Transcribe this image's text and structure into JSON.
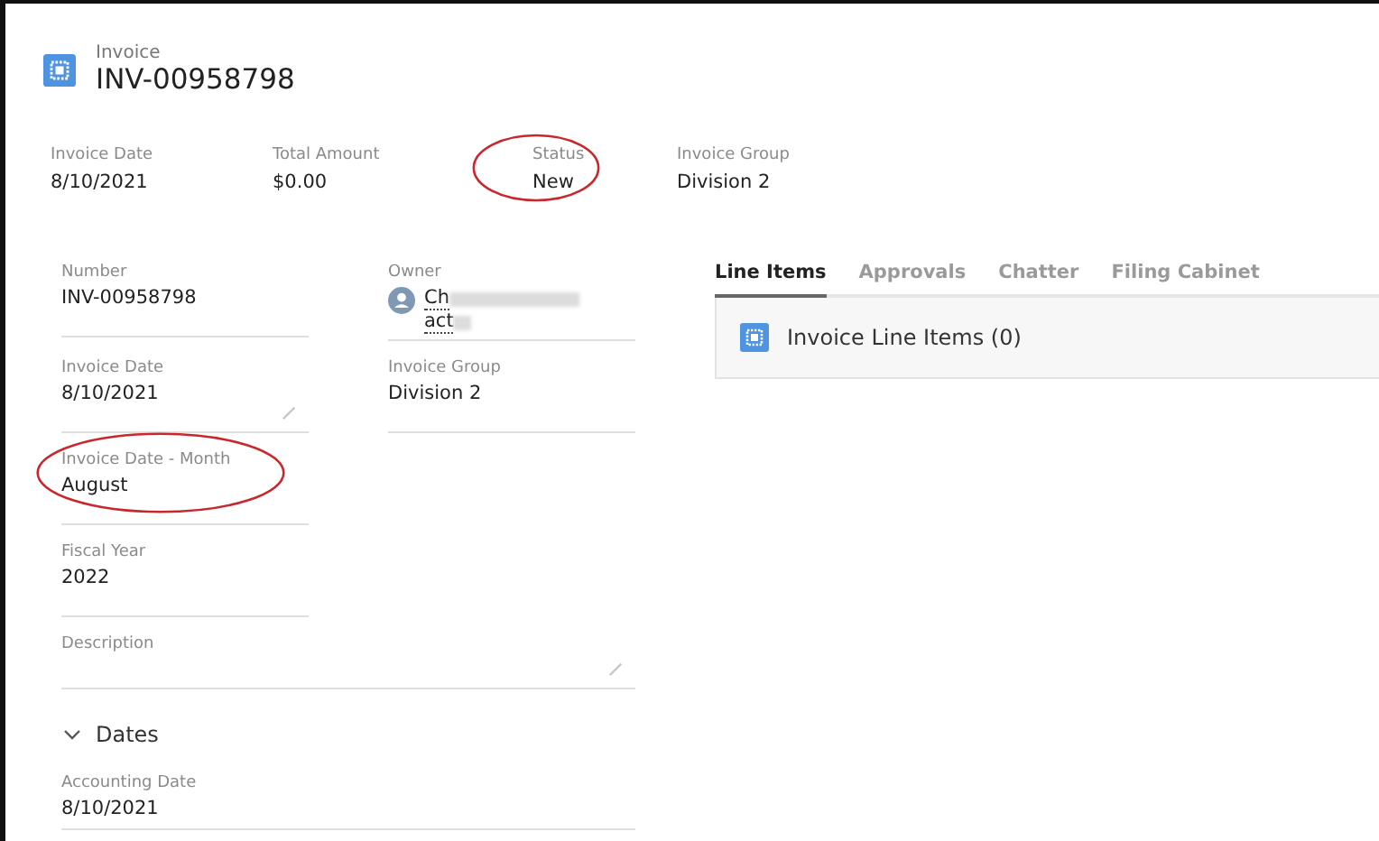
{
  "record": {
    "object_label": "Invoice",
    "title": "INV-00958798"
  },
  "highlights": [
    {
      "label": "Invoice Date",
      "value": "8/10/2021",
      "circled": false
    },
    {
      "label": "Total Amount",
      "value": "$0.00",
      "circled": false
    },
    {
      "label": "Status",
      "value": "New",
      "circled": true
    },
    {
      "label": "Invoice Group",
      "value": "Division 2",
      "circled": false
    }
  ],
  "fields": [
    {
      "kind": "text",
      "label": "Number",
      "value": "INV-00958798",
      "editable": false,
      "circled": false
    },
    {
      "kind": "owner",
      "label": "Owner",
      "value": "Ch",
      "value_line_2": "act"
    },
    {
      "kind": "text",
      "label": "Invoice Date",
      "value": "8/10/2021",
      "editable": true,
      "circled": false
    },
    {
      "kind": "text",
      "label": "Invoice Group",
      "value": "Division 2",
      "editable": false,
      "circled": false
    },
    {
      "kind": "text",
      "label": "Invoice Date - Month",
      "value": "August",
      "editable": false,
      "circled": true
    },
    {
      "kind": "empty"
    },
    {
      "kind": "text",
      "label": "Fiscal Year",
      "value": "2022",
      "editable": false,
      "circled": false
    },
    {
      "kind": "empty"
    },
    {
      "kind": "wide",
      "label": "Description",
      "editable": true
    }
  ],
  "section": {
    "title": "Dates",
    "expanded": true,
    "fields": [
      {
        "label": "Accounting Date",
        "value": "8/10/2021"
      }
    ]
  },
  "tabs": [
    {
      "label": "Line Items",
      "selected": true
    },
    {
      "label": "Approvals",
      "selected": false
    },
    {
      "label": "Chatter",
      "selected": false
    },
    {
      "label": "Filing Cabinet",
      "selected": false
    }
  ],
  "related": {
    "title": "Invoice Line Items (0)"
  }
}
